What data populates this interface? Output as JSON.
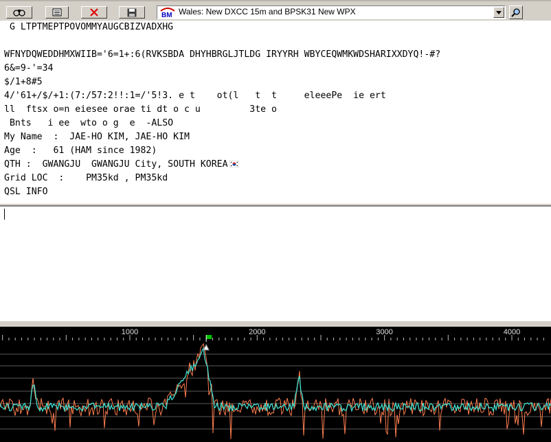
{
  "toolbar": {
    "buttons": [
      {
        "name": "binoculars-button",
        "icon": "binoculars-icon"
      },
      {
        "name": "log-button",
        "icon": "notepad-icon"
      },
      {
        "name": "clear-button",
        "icon": "red-x-icon"
      },
      {
        "name": "save-button",
        "icon": "floppy-disk-icon"
      }
    ],
    "dx_alert": {
      "logo": "BM",
      "text": "Wales:  New DXCC 15m and BPSK31 New WPX"
    }
  },
  "rx": {
    "lines": [
      " G LTPTMEPTPOVOMMYAUGCBIZVADXHG",
      "",
      "WFNYDQWEDDHMXWIIB='6=1+:6(RVKSBDA DHYHBRGLJTLDG IRYYRH WBYCEQWMKWDSHARIXXDYQ!-#?",
      "6&=9-'=34",
      "$/1+8#5",
      "4/'61+/$/+1:(7:/57:2!!:1=/'5!3. e t    ot(l   t  t     eleeePe  ie ert",
      "ll  ftsx o=n eiesee orae ti dt o c u         3te o",
      " Bnts   i ee  wto o g  e  -ALSO",
      "My Name  :  JAE-HO KIM, JAE-HO KIM",
      "Age  :   61 (HAM since 1982)",
      "QTH :  GWANGJU  GWANGJU City, SOUTH KOREA",
      "Grid LOC  :    PM35kd , PM35kd",
      "QSL INFO"
    ]
  },
  "tx": {
    "text": ""
  },
  "spectrum": {
    "tick_labels": [
      "1000",
      "2000",
      "3000",
      "4000"
    ],
    "tick_values": [
      1000,
      2000,
      3000,
      4000
    ],
    "cursor_freq": 1600,
    "colors": {
      "background": "#000000",
      "trace_orange": "#ff7f50",
      "trace_cyan": "#40e0d0",
      "cursor_flag": "#00c000"
    }
  }
}
